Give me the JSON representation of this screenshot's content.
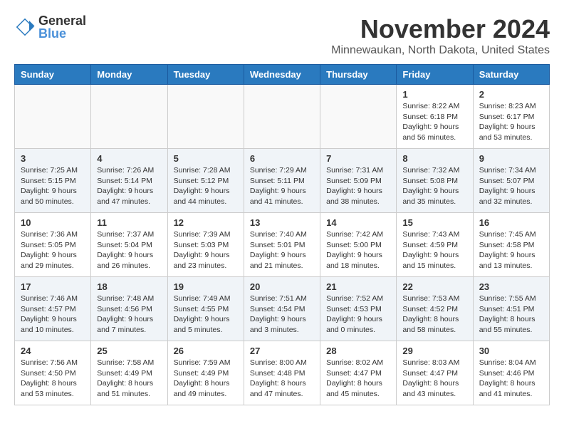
{
  "header": {
    "logo_line1": "General",
    "logo_line2": "Blue",
    "month_title": "November 2024",
    "location": "Minnewaukan, North Dakota, United States"
  },
  "columns": [
    "Sunday",
    "Monday",
    "Tuesday",
    "Wednesday",
    "Thursday",
    "Friday",
    "Saturday"
  ],
  "weeks": [
    [
      {
        "day": "",
        "info": ""
      },
      {
        "day": "",
        "info": ""
      },
      {
        "day": "",
        "info": ""
      },
      {
        "day": "",
        "info": ""
      },
      {
        "day": "",
        "info": ""
      },
      {
        "day": "1",
        "info": "Sunrise: 8:22 AM\nSunset: 6:18 PM\nDaylight: 9 hours and 56 minutes."
      },
      {
        "day": "2",
        "info": "Sunrise: 8:23 AM\nSunset: 6:17 PM\nDaylight: 9 hours and 53 minutes."
      }
    ],
    [
      {
        "day": "3",
        "info": "Sunrise: 7:25 AM\nSunset: 5:15 PM\nDaylight: 9 hours and 50 minutes."
      },
      {
        "day": "4",
        "info": "Sunrise: 7:26 AM\nSunset: 5:14 PM\nDaylight: 9 hours and 47 minutes."
      },
      {
        "day": "5",
        "info": "Sunrise: 7:28 AM\nSunset: 5:12 PM\nDaylight: 9 hours and 44 minutes."
      },
      {
        "day": "6",
        "info": "Sunrise: 7:29 AM\nSunset: 5:11 PM\nDaylight: 9 hours and 41 minutes."
      },
      {
        "day": "7",
        "info": "Sunrise: 7:31 AM\nSunset: 5:09 PM\nDaylight: 9 hours and 38 minutes."
      },
      {
        "day": "8",
        "info": "Sunrise: 7:32 AM\nSunset: 5:08 PM\nDaylight: 9 hours and 35 minutes."
      },
      {
        "day": "9",
        "info": "Sunrise: 7:34 AM\nSunset: 5:07 PM\nDaylight: 9 hours and 32 minutes."
      }
    ],
    [
      {
        "day": "10",
        "info": "Sunrise: 7:36 AM\nSunset: 5:05 PM\nDaylight: 9 hours and 29 minutes."
      },
      {
        "day": "11",
        "info": "Sunrise: 7:37 AM\nSunset: 5:04 PM\nDaylight: 9 hours and 26 minutes."
      },
      {
        "day": "12",
        "info": "Sunrise: 7:39 AM\nSunset: 5:03 PM\nDaylight: 9 hours and 23 minutes."
      },
      {
        "day": "13",
        "info": "Sunrise: 7:40 AM\nSunset: 5:01 PM\nDaylight: 9 hours and 21 minutes."
      },
      {
        "day": "14",
        "info": "Sunrise: 7:42 AM\nSunset: 5:00 PM\nDaylight: 9 hours and 18 minutes."
      },
      {
        "day": "15",
        "info": "Sunrise: 7:43 AM\nSunset: 4:59 PM\nDaylight: 9 hours and 15 minutes."
      },
      {
        "day": "16",
        "info": "Sunrise: 7:45 AM\nSunset: 4:58 PM\nDaylight: 9 hours and 13 minutes."
      }
    ],
    [
      {
        "day": "17",
        "info": "Sunrise: 7:46 AM\nSunset: 4:57 PM\nDaylight: 9 hours and 10 minutes."
      },
      {
        "day": "18",
        "info": "Sunrise: 7:48 AM\nSunset: 4:56 PM\nDaylight: 9 hours and 7 minutes."
      },
      {
        "day": "19",
        "info": "Sunrise: 7:49 AM\nSunset: 4:55 PM\nDaylight: 9 hours and 5 minutes."
      },
      {
        "day": "20",
        "info": "Sunrise: 7:51 AM\nSunset: 4:54 PM\nDaylight: 9 hours and 3 minutes."
      },
      {
        "day": "21",
        "info": "Sunrise: 7:52 AM\nSunset: 4:53 PM\nDaylight: 9 hours and 0 minutes."
      },
      {
        "day": "22",
        "info": "Sunrise: 7:53 AM\nSunset: 4:52 PM\nDaylight: 8 hours and 58 minutes."
      },
      {
        "day": "23",
        "info": "Sunrise: 7:55 AM\nSunset: 4:51 PM\nDaylight: 8 hours and 55 minutes."
      }
    ],
    [
      {
        "day": "24",
        "info": "Sunrise: 7:56 AM\nSunset: 4:50 PM\nDaylight: 8 hours and 53 minutes."
      },
      {
        "day": "25",
        "info": "Sunrise: 7:58 AM\nSunset: 4:49 PM\nDaylight: 8 hours and 51 minutes."
      },
      {
        "day": "26",
        "info": "Sunrise: 7:59 AM\nSunset: 4:49 PM\nDaylight: 8 hours and 49 minutes."
      },
      {
        "day": "27",
        "info": "Sunrise: 8:00 AM\nSunset: 4:48 PM\nDaylight: 8 hours and 47 minutes."
      },
      {
        "day": "28",
        "info": "Sunrise: 8:02 AM\nSunset: 4:47 PM\nDaylight: 8 hours and 45 minutes."
      },
      {
        "day": "29",
        "info": "Sunrise: 8:03 AM\nSunset: 4:47 PM\nDaylight: 8 hours and 43 minutes."
      },
      {
        "day": "30",
        "info": "Sunrise: 8:04 AM\nSunset: 4:46 PM\nDaylight: 8 hours and 41 minutes."
      }
    ]
  ]
}
